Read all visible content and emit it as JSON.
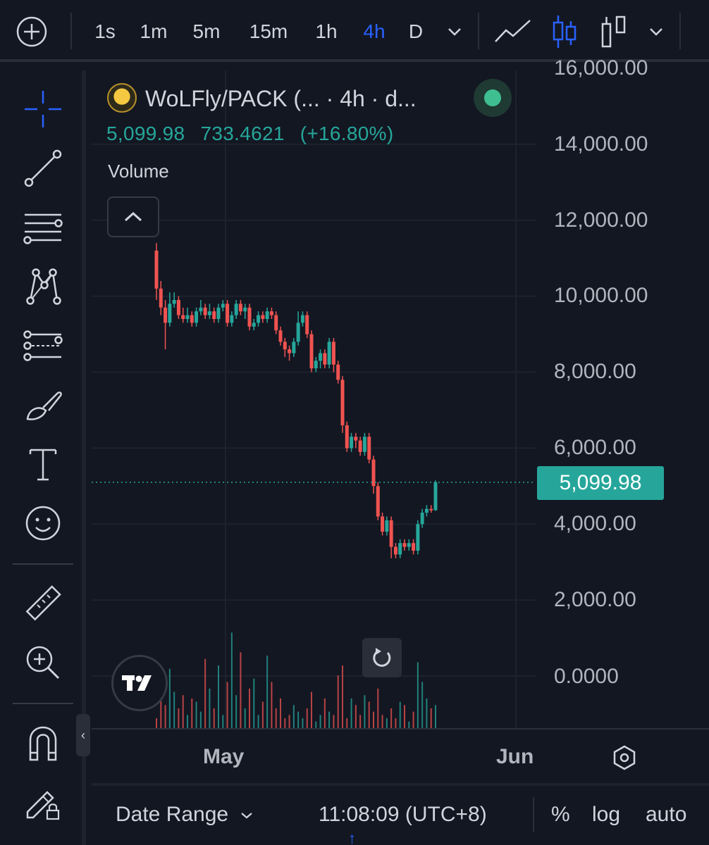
{
  "toolbar": {
    "add_icon": "plus-circle-icon",
    "timeframes": [
      "1s",
      "1m",
      "5m",
      "15m",
      "1h",
      "4h",
      "D"
    ],
    "active_timeframe": "4h",
    "timeframe_dropdown_icon": "chevron-down-icon",
    "chart_types": [
      "line-chart-icon",
      "candles-icon",
      "bars-icon"
    ],
    "active_chart_type": "candles-icon",
    "chart_type_dropdown_icon": "chevron-down-icon"
  },
  "left_tools": [
    "crosshair-icon",
    "trend-line-icon",
    "horizontal-lines-icon",
    "pattern-icon",
    "forecast-icon",
    "brush-icon",
    "text-icon",
    "emoji-icon",
    "ruler-icon",
    "zoom-in-icon",
    "magnet-icon",
    "lock-drawings-icon"
  ],
  "legend": {
    "symbol_title": "WoLFly/PACK (... · 4h · d...",
    "close": "5,099.98",
    "change": "733.4621",
    "change_pct": "(+16.80%)",
    "volume_label": "Volume"
  },
  "current_price_label": "5,099.98",
  "price_axis": [
    "16,000.00",
    "14,000.00",
    "12,000.00",
    "10,000.00",
    "8,000.00",
    "6,000.00",
    "4,000.00",
    "2,000.00",
    "0.0000"
  ],
  "time_axis": [
    "May",
    "Jun"
  ],
  "bottom": {
    "date_range": "Date Range",
    "clock": "11:08:09 (UTC+8)",
    "percent": "%",
    "log": "log",
    "auto": "auto"
  },
  "colors": {
    "up": "#26a69a",
    "down": "#ef5350",
    "accent": "#2962ff",
    "background": "#131722"
  },
  "chart_data": {
    "type": "candlestick",
    "timeframe": "4h",
    "symbol": "WoLFly/PACK",
    "ylim": [
      0,
      16000
    ],
    "x_ticks": [
      "May",
      "Jun"
    ],
    "last_price": 5099.98,
    "candles": [
      [
        11200,
        10200,
        11400,
        9900
      ],
      [
        10200,
        9700,
        10400,
        9500
      ],
      [
        9700,
        9300,
        9900,
        8600
      ],
      [
        9300,
        9800,
        10100,
        9200
      ],
      [
        9800,
        9900,
        10100,
        9700
      ],
      [
        9900,
        9500,
        10000,
        9400
      ],
      [
        9500,
        9400,
        9700,
        9300
      ],
      [
        9400,
        9500,
        9700,
        9300
      ],
      [
        9500,
        9300,
        9600,
        9200
      ],
      [
        9300,
        9600,
        9700,
        9200
      ],
      [
        9600,
        9700,
        9900,
        9500
      ],
      [
        9700,
        9500,
        9800,
        9400
      ],
      [
        9500,
        9600,
        9800,
        9400
      ],
      [
        9600,
        9400,
        9700,
        9300
      ],
      [
        9400,
        9700,
        9800,
        9300
      ],
      [
        9700,
        9800,
        9900,
        9600
      ],
      [
        9800,
        9300,
        9900,
        9200
      ],
      [
        9300,
        9500,
        9600,
        9200
      ],
      [
        9500,
        9800,
        9900,
        9400
      ],
      [
        9800,
        9600,
        9900,
        9500
      ],
      [
        9600,
        9700,
        9800,
        9400
      ],
      [
        9700,
        9200,
        9800,
        9100
      ],
      [
        9200,
        9300,
        9400,
        9100
      ],
      [
        9300,
        9500,
        9600,
        9200
      ],
      [
        9500,
        9400,
        9600,
        9300
      ],
      [
        9400,
        9600,
        9700,
        9300
      ],
      [
        9600,
        9500,
        9700,
        9400
      ],
      [
        9500,
        9100,
        9600,
        9000
      ],
      [
        9100,
        8800,
        9200,
        8700
      ],
      [
        8800,
        8600,
        8900,
        8400
      ],
      [
        8600,
        8500,
        8700,
        8300
      ],
      [
        8500,
        8800,
        8900,
        8400
      ],
      [
        8800,
        9300,
        9600,
        8700
      ],
      [
        9300,
        9500,
        9600,
        9200
      ],
      [
        9500,
        9000,
        9600,
        8900
      ],
      [
        9000,
        8100,
        9100,
        8000
      ],
      [
        8100,
        8300,
        8400,
        8000
      ],
      [
        8300,
        8500,
        8600,
        8100
      ],
      [
        8500,
        8200,
        8600,
        8100
      ],
      [
        8200,
        8800,
        8900,
        8100
      ],
      [
        8800,
        8200,
        8900,
        8000
      ],
      [
        8200,
        7800,
        8300,
        7700
      ],
      [
        7800,
        6600,
        7900,
        6400
      ],
      [
        6600,
        6000,
        6700,
        5900
      ],
      [
        6000,
        6300,
        6400,
        5900
      ],
      [
        6300,
        6200,
        6400,
        6000
      ],
      [
        6200,
        5900,
        6300,
        5800
      ],
      [
        5900,
        6300,
        6400,
        5800
      ],
      [
        6300,
        5700,
        6400,
        5600
      ],
      [
        5700,
        5000,
        5800,
        4800
      ],
      [
        5000,
        4200,
        5100,
        4100
      ],
      [
        4200,
        3800,
        4300,
        3700
      ],
      [
        3800,
        4100,
        4200,
        3700
      ],
      [
        4100,
        3400,
        4200,
        3100
      ],
      [
        3400,
        3200,
        3500,
        3100
      ],
      [
        3200,
        3500,
        3600,
        3100
      ],
      [
        3500,
        3400,
        3600,
        3300
      ],
      [
        3400,
        3500,
        3600,
        3300
      ],
      [
        3500,
        3300,
        3600,
        3200
      ],
      [
        3300,
        4000,
        4100,
        3200
      ],
      [
        4000,
        4300,
        4400,
        3900
      ],
      [
        4300,
        4400,
        4500,
        4200
      ],
      [
        4400,
        4366,
        4500,
        4300
      ],
      [
        4366,
        5099.98,
        5150,
        4350
      ]
    ],
    "volume_ylim": [
      0,
      5000
    ],
    "volumes": [
      300,
      900,
      700,
      1800,
      1100,
      600,
      1000,
      400,
      900,
      800,
      500,
      2100,
      1200,
      600,
      1900,
      400,
      1400,
      2900,
      1000,
      2300,
      600,
      1200,
      1500,
      400,
      800,
      2200,
      1400,
      600,
      900,
      300,
      400,
      700,
      500,
      300,
      600,
      1100,
      200,
      400,
      900,
      500,
      400,
      1600,
      1900,
      300,
      900,
      700,
      400,
      1000,
      800,
      500,
      1200,
      400,
      300,
      600,
      300,
      800,
      700,
      200,
      500,
      2000,
      1400,
      900,
      600,
      700
    ]
  }
}
